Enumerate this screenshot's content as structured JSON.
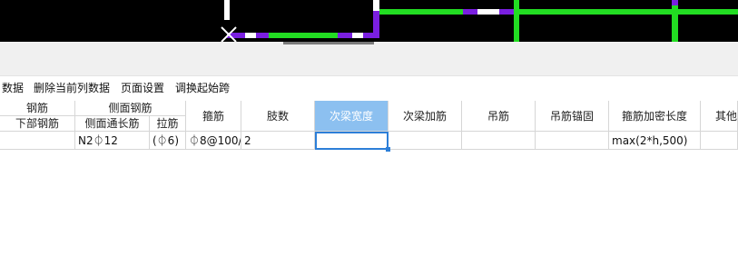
{
  "toolbar": {
    "items": [
      "数据",
      "删除当前列数据",
      "页面设置",
      "调换起始跨"
    ]
  },
  "table": {
    "group_headers": [
      "钢筋",
      "侧面钢筋"
    ],
    "sub_headers": [
      "下部钢筋",
      "侧面通长筋",
      "拉筋"
    ],
    "columns": [
      "箍筋",
      "肢数",
      "次梁宽度",
      "次梁加筋",
      "吊筋",
      "吊筋锚固",
      "箍筋加密长度",
      "其他"
    ],
    "row": {
      "bottom_rebar": "",
      "side_through_rebar": "N2⏀12",
      "tie_bar": "(⏀6)",
      "stirrup": "⏀8@100/",
      "legs": "2",
      "secondary_beam_width": "",
      "secondary_beam_rebar": "",
      "hanger_bar": "",
      "hanger_anchor": "",
      "stirrup_dense_length": "max(2*h,500)",
      "other": ""
    }
  },
  "colors": {
    "canvas": "#000000",
    "green_line": "#22dd22",
    "purple_line": "#7a1fe0",
    "white_line": "#ffffff",
    "selected_header": "#8cc0f0",
    "active_border": "#2d7fd8"
  }
}
